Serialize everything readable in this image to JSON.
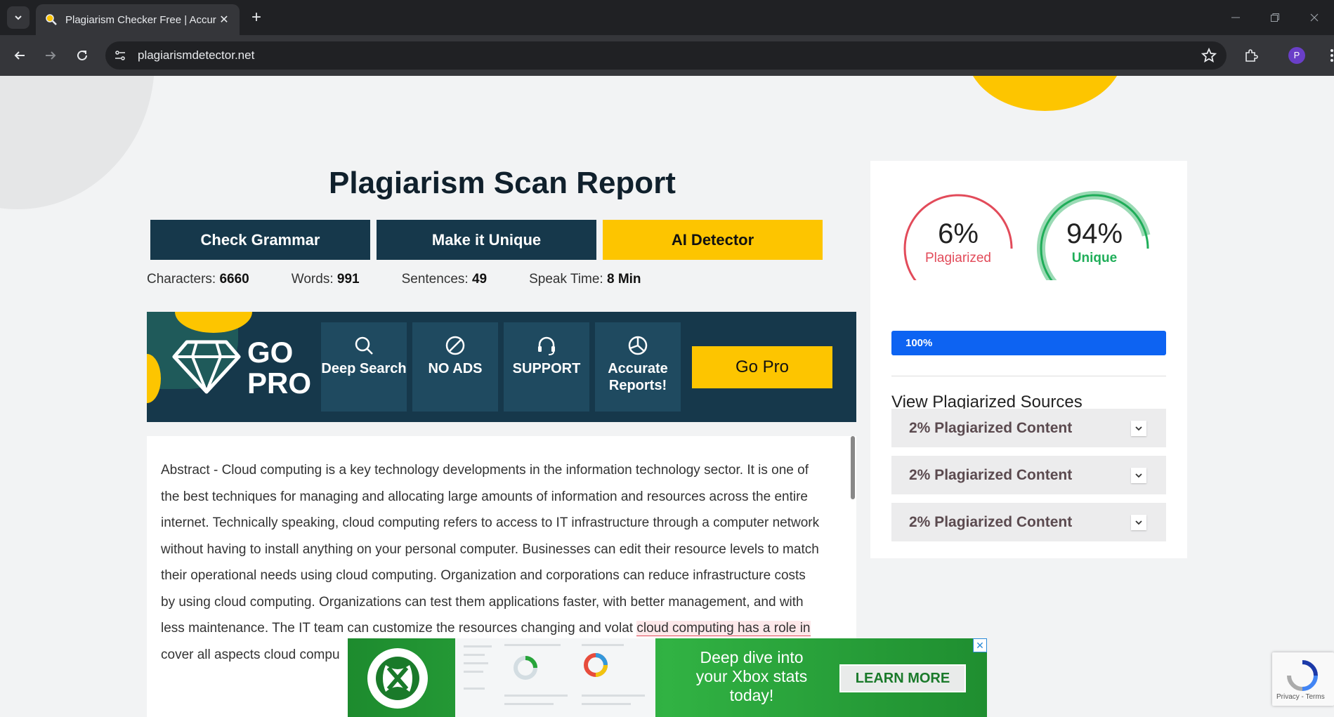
{
  "browser": {
    "tab_title": "Plagiarism Checker Free | Accur",
    "url": "plagiarismdetector.net",
    "profile_initial": "P"
  },
  "page": {
    "title": "Plagiarism Scan Report",
    "actions": {
      "check_grammar": "Check Grammar",
      "make_unique": "Make it Unique",
      "ai_detector": "AI Detector"
    },
    "stats": {
      "characters_label": "Characters:",
      "characters_value": "6660",
      "words_label": "Words:",
      "words_value": "991",
      "sentences_label": "Sentences:",
      "sentences_value": "49",
      "speak_time_label": "Speak Time:",
      "speak_time_value": "8 Min"
    },
    "gopro": {
      "line1": "GO",
      "line2": "PRO",
      "features": [
        {
          "label": "Deep Search",
          "icon": "search-icon"
        },
        {
          "label": "NO ADS",
          "icon": "no-ads-icon"
        },
        {
          "label": "SUPPORT",
          "icon": "headset-icon"
        },
        {
          "label": "Accurate Reports!",
          "icon": "pie-chart-icon"
        }
      ],
      "button": "Go Pro"
    },
    "content": {
      "text_1": "Abstract - Cloud computing is a key technology developments in the information technology sector. It is one of the best techniques for managing and allocating large amounts of information and resources across the entire internet. Technically speaking, cloud computing refers to access to IT infrastructure through a computer network without having to install anything on your personal computer. Businesses can edit their resource levels to match their operational needs using cloud computing. Organization and corporations can reduce infrastructure costs by using cloud computing. Organizations can test them applications faster, with better management, and with less maintenance. The IT team can customize the resources changing and volat",
      "highlight": "cloud computing has a role in",
      "text_2": " cover all aspects cloud compu"
    },
    "results": {
      "plagiarized_percent": "6%",
      "plagiarized_label": "Plagiarized",
      "plagiarized_fraction": 0.06,
      "unique_percent": "94%",
      "unique_label": "Unique",
      "unique_fraction": 0.94,
      "progress_label": "100%",
      "progress_fraction": 1.0,
      "sources_title": "View Plagiarized Sources",
      "sources": [
        "2% Plagiarized Content",
        "2% Plagiarized Content",
        "2% Plagiarized Content"
      ]
    },
    "ad": {
      "headline": "Deep dive into your Xbox stats today!",
      "cta": "LEARN MORE",
      "close": "✕"
    },
    "recaptcha": {
      "links": "Privacy - Terms"
    }
  },
  "colors": {
    "dark_blue": "#16384b",
    "yellow": "#fdc500",
    "plagiarized_red": "#e24b5a",
    "unique_green": "#1fae59",
    "progress_blue": "#0d63f2"
  }
}
